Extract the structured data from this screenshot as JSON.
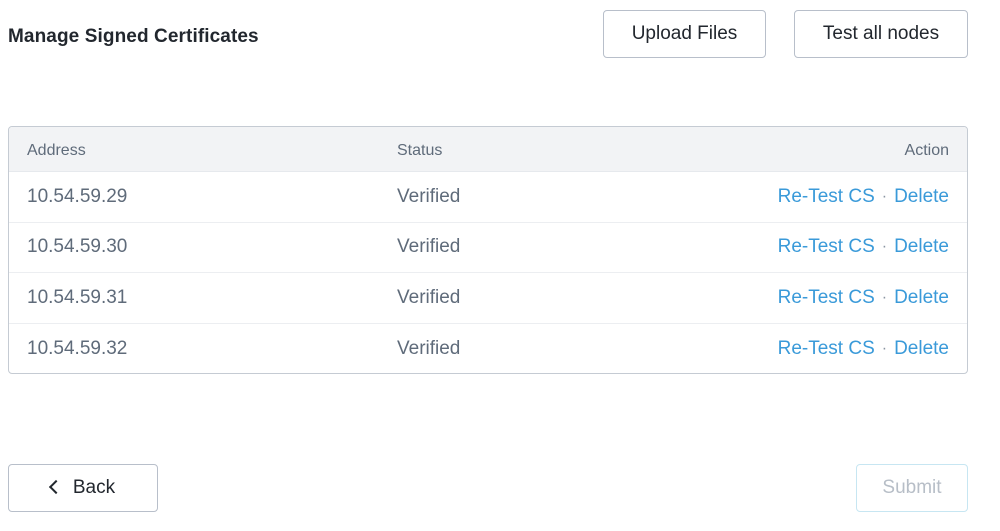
{
  "header": {
    "title": "Manage Signed Certificates",
    "upload_label": "Upload Files",
    "test_all_label": "Test all nodes"
  },
  "table": {
    "columns": {
      "address": "Address",
      "status": "Status",
      "action": "Action"
    },
    "rows": [
      {
        "address": "10.54.59.29",
        "status": "Verified",
        "retest": "Re-Test CS",
        "delete": "Delete"
      },
      {
        "address": "10.54.59.30",
        "status": "Verified",
        "retest": "Re-Test CS",
        "delete": "Delete"
      },
      {
        "address": "10.54.59.31",
        "status": "Verified",
        "retest": "Re-Test CS",
        "delete": "Delete"
      },
      {
        "address": "10.54.59.32",
        "status": "Verified",
        "retest": "Re-Test CS",
        "delete": "Delete"
      }
    ],
    "action_separator": "·"
  },
  "footer": {
    "back_label": "Back",
    "submit_label": "Submit",
    "submit_disabled": true
  },
  "colors": {
    "link": "#3a9ad9",
    "text": "#22272e",
    "muted": "#5f6b7a",
    "header_bg": "#f2f3f5",
    "disabled_text": "#b7bec7"
  },
  "icons": {
    "back": "chevron-left-icon"
  }
}
